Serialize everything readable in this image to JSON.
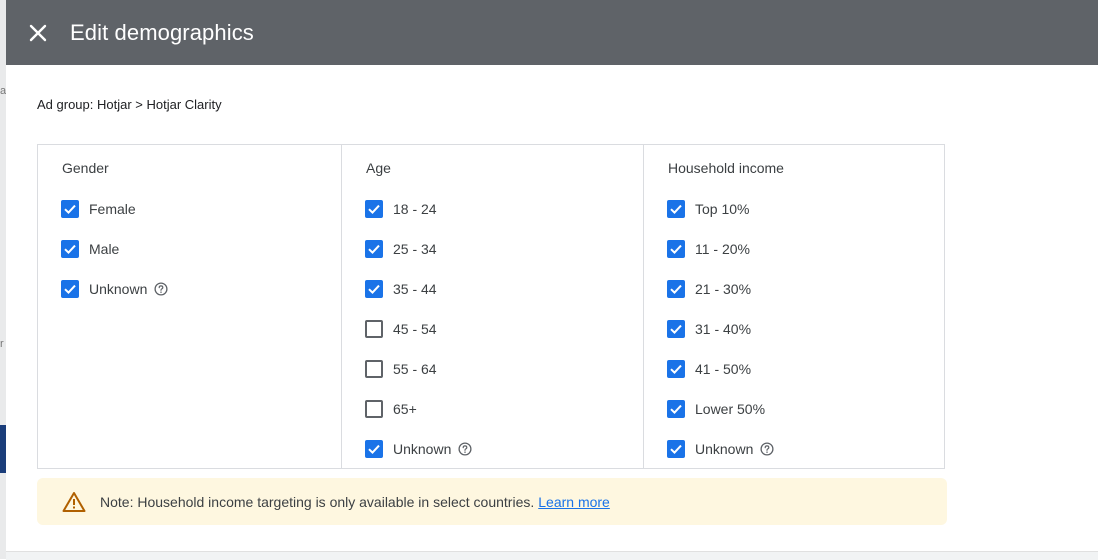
{
  "underlay": {
    "mark_a": "a",
    "mark_r": "r"
  },
  "dialog": {
    "title": "Edit demographics",
    "close_icon": "close-icon",
    "ad_group": "Ad group: Hotjar > Hotjar Clarity"
  },
  "gender": {
    "title": "Gender",
    "options": [
      {
        "label": "Female",
        "checked": true
      },
      {
        "label": "Male",
        "checked": true
      },
      {
        "label": "Unknown",
        "checked": true,
        "help": true
      }
    ]
  },
  "age": {
    "title": "Age",
    "options": [
      {
        "label": "18 - 24",
        "checked": true
      },
      {
        "label": "25 - 34",
        "checked": true
      },
      {
        "label": "35 - 44",
        "checked": true
      },
      {
        "label": "45 - 54",
        "checked": false
      },
      {
        "label": "55 - 64",
        "checked": false
      },
      {
        "label": "65+",
        "checked": false
      },
      {
        "label": "Unknown",
        "checked": true,
        "help": true
      }
    ]
  },
  "income": {
    "title": "Household income",
    "options": [
      {
        "label": "Top 10%",
        "checked": true
      },
      {
        "label": "11 - 20%",
        "checked": true
      },
      {
        "label": "21 - 30%",
        "checked": true
      },
      {
        "label": "31 - 40%",
        "checked": true
      },
      {
        "label": "41 - 50%",
        "checked": true
      },
      {
        "label": "Lower 50%",
        "checked": true
      },
      {
        "label": "Unknown",
        "checked": true,
        "help": true
      }
    ]
  },
  "note": {
    "icon": "warning-icon",
    "text": "Note: Household income targeting is only available in select countries.",
    "link": "Learn more"
  },
  "colors": {
    "header": "#5f6368",
    "checkbox": "#1a73e8",
    "note_bg": "#fef7e0",
    "warning": "#b06000"
  }
}
